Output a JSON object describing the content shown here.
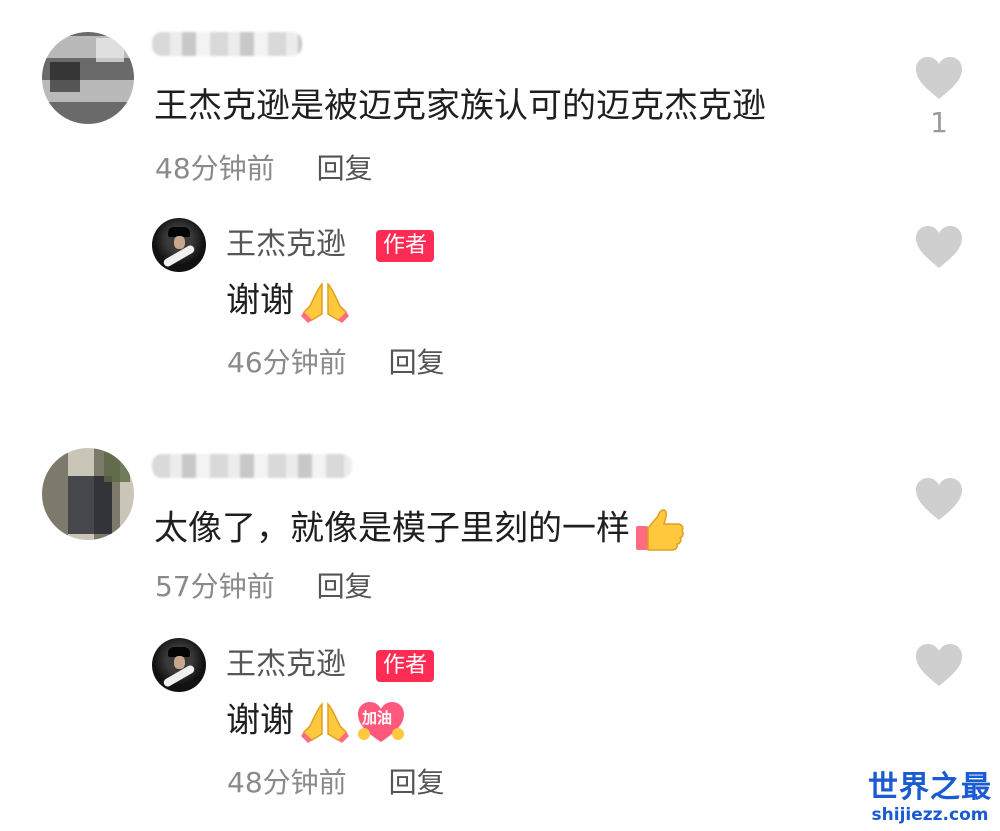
{
  "comments": [
    {
      "text": "王杰克逊是被迈克家族认可的迈克杰克逊",
      "time": "48分钟前",
      "reply_label": "回复",
      "like_count": "1",
      "like_icon": "heart-icon",
      "reply": {
        "author": "王杰克逊",
        "badge": "作者",
        "text": "谢谢",
        "emojis": [
          "pray-emoji"
        ],
        "time": "46分钟前",
        "reply_label": "回复",
        "like_icon": "heart-icon"
      }
    },
    {
      "text": "太像了，就像是模子里刻的一样",
      "time": "57分钟前",
      "reply_label": "回复",
      "like_icon": "heart-icon",
      "emojis": [
        "thumbs-up-emoji"
      ],
      "reply": {
        "author": "王杰克逊",
        "badge": "作者",
        "text": "谢谢",
        "emojis": [
          "pray-emoji",
          "jiayou-heart-emoji"
        ],
        "jiayou_text": "加油",
        "time": "48分钟前",
        "reply_label": "回复",
        "like_icon": "heart-icon"
      }
    }
  ],
  "watermark": {
    "title": "世界之最",
    "url": "shijiezz.com"
  },
  "colors": {
    "badge": "#fe2c55",
    "heart": "#cfcfcf",
    "meta": "#8a8a8a",
    "watermark": "#1a5bd1"
  }
}
